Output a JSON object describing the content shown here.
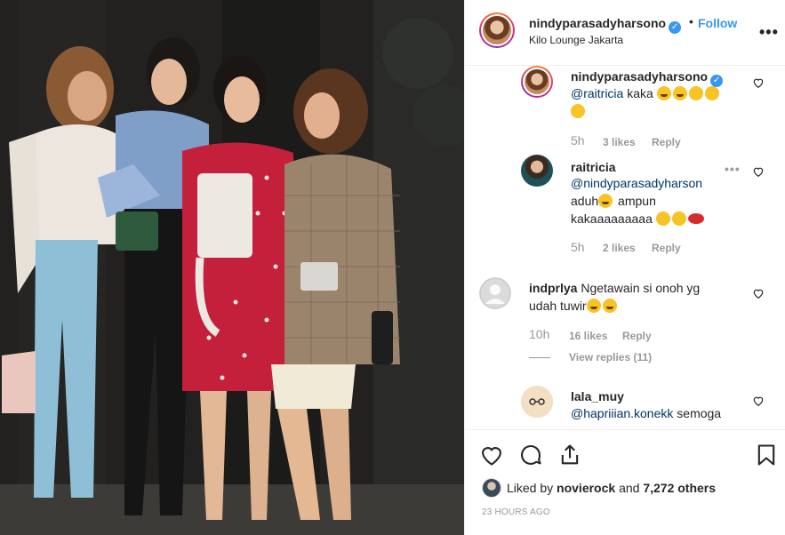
{
  "header": {
    "username": "nindyparasadyharsono",
    "follow_label": "Follow",
    "separator": "•",
    "location": "Kilo Lounge Jakarta",
    "more": "•••"
  },
  "comments": [
    {
      "username": "nindyparasadyharsono",
      "mention": "@raitricia",
      "text": " kaka",
      "time": "5h",
      "likes": "3 likes",
      "reply": "Reply"
    },
    {
      "username": "raitricia",
      "mention": "@nindyparasadyharson",
      "text_line2": "aduh",
      "text_line2b": " ampun",
      "text_line3": "kakaaaaaaaaa ",
      "time": "5h",
      "likes": "2 likes",
      "reply": "Reply",
      "more": "•••"
    },
    {
      "username": "indprlya",
      "text": " Ngetawain si onoh yg",
      "text_line2": "udah tuwir",
      "time": "10h",
      "likes": "16 likes",
      "reply": "Reply",
      "view_replies": "View replies (11)"
    },
    {
      "username": "lala_muy",
      "mention": "@hapriiian.konekk",
      "text": " semoga"
    }
  ],
  "footer": {
    "liked_prefix": "Liked by ",
    "liked_user": "novierock",
    "liked_and": " and ",
    "liked_count": "7,272 others",
    "timestamp": "23 HOURS AGO"
  },
  "icons": {
    "like": "heart-icon",
    "comment": "comment-icon",
    "share": "share-icon",
    "save": "bookmark-icon"
  },
  "colors": {
    "link": "#3897f0",
    "mention": "#003569",
    "muted": "#999999",
    "text": "#262626",
    "dress": "#c41f3b"
  }
}
